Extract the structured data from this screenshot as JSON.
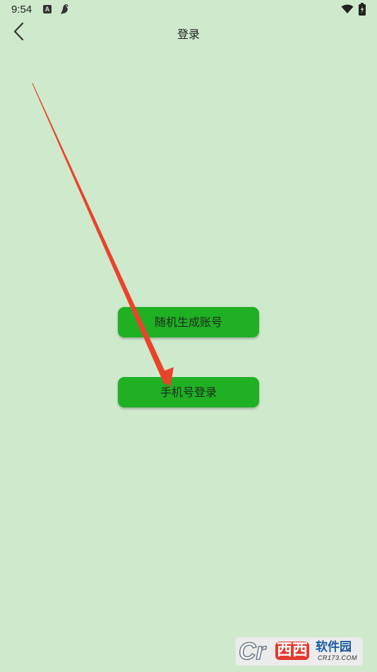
{
  "status_bar": {
    "time": "9:54",
    "notification_icon_letter": "A"
  },
  "app_bar": {
    "title": "登录",
    "back_icon": "chevron-left-icon"
  },
  "buttons": {
    "random_account": "随机生成账号",
    "phone_login": "手机号登录"
  },
  "annotation": {
    "arrow_color": "#e8442c"
  },
  "watermark": {
    "logo": "Cr",
    "brand": "西西",
    "name": "软件园",
    "domain": "CR173.COM"
  },
  "colors": {
    "background": "#cfe9cc",
    "button": "#1fb024"
  }
}
